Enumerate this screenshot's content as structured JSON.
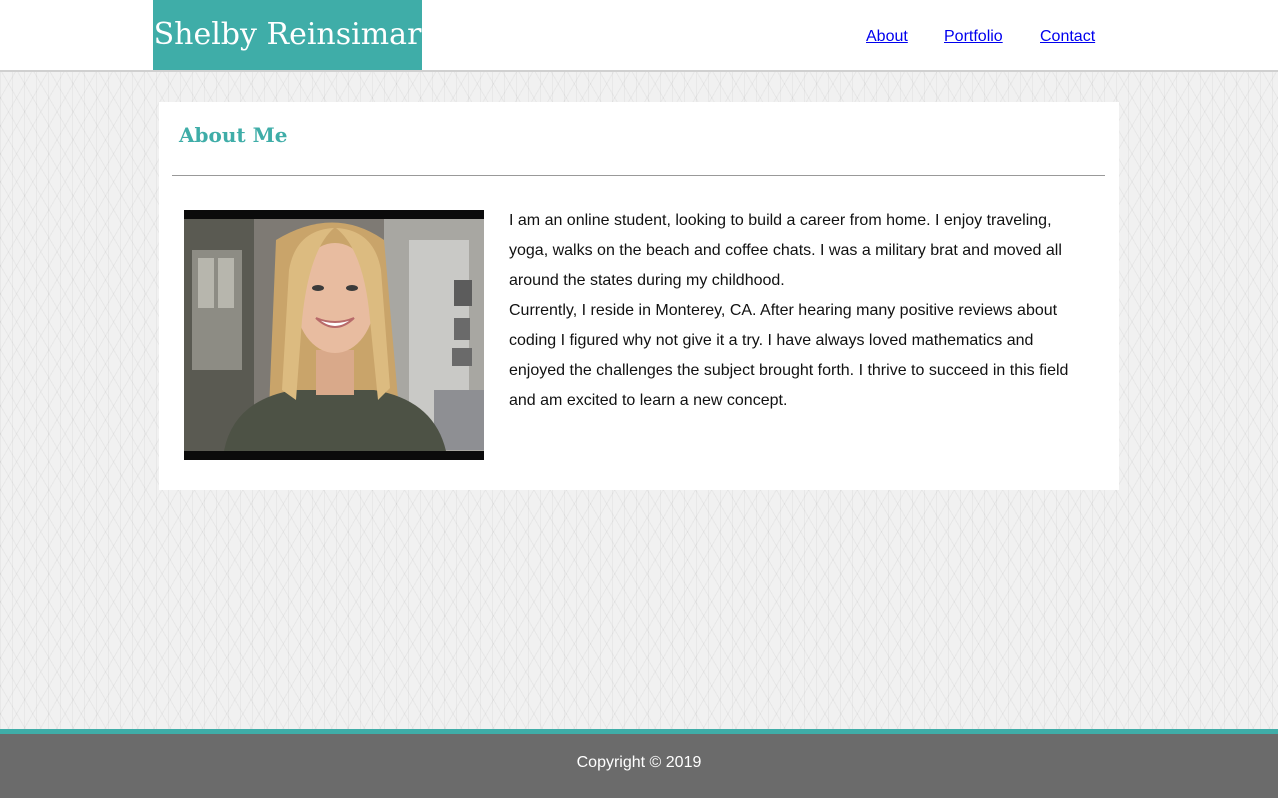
{
  "header": {
    "brand": "Shelby Reinsimar",
    "nav": [
      {
        "label": "About"
      },
      {
        "label": "Portfolio"
      },
      {
        "label": "Contact"
      }
    ]
  },
  "main": {
    "heading": "About Me",
    "bio": [
      "I am an online student, looking to build a career from home. I enjoy traveling, yoga, walks on the beach and coffee chats. I was a military brat and moved all around the states during my childhood.",
      "Currently, I reside in Monterey, CA. After hearing many positive reviews about coding I figured why not give it a try. I have always loved mathematics and enjoyed the challenges the subject brought forth. I thrive to succeed in this field and am excited to learn a new concept."
    ]
  },
  "footer": {
    "copyright": "Copyright © 2019"
  },
  "colors": {
    "accent": "#3fada8",
    "footer_bg": "#6b6b6b",
    "nav_text": "#9a9a9a"
  }
}
